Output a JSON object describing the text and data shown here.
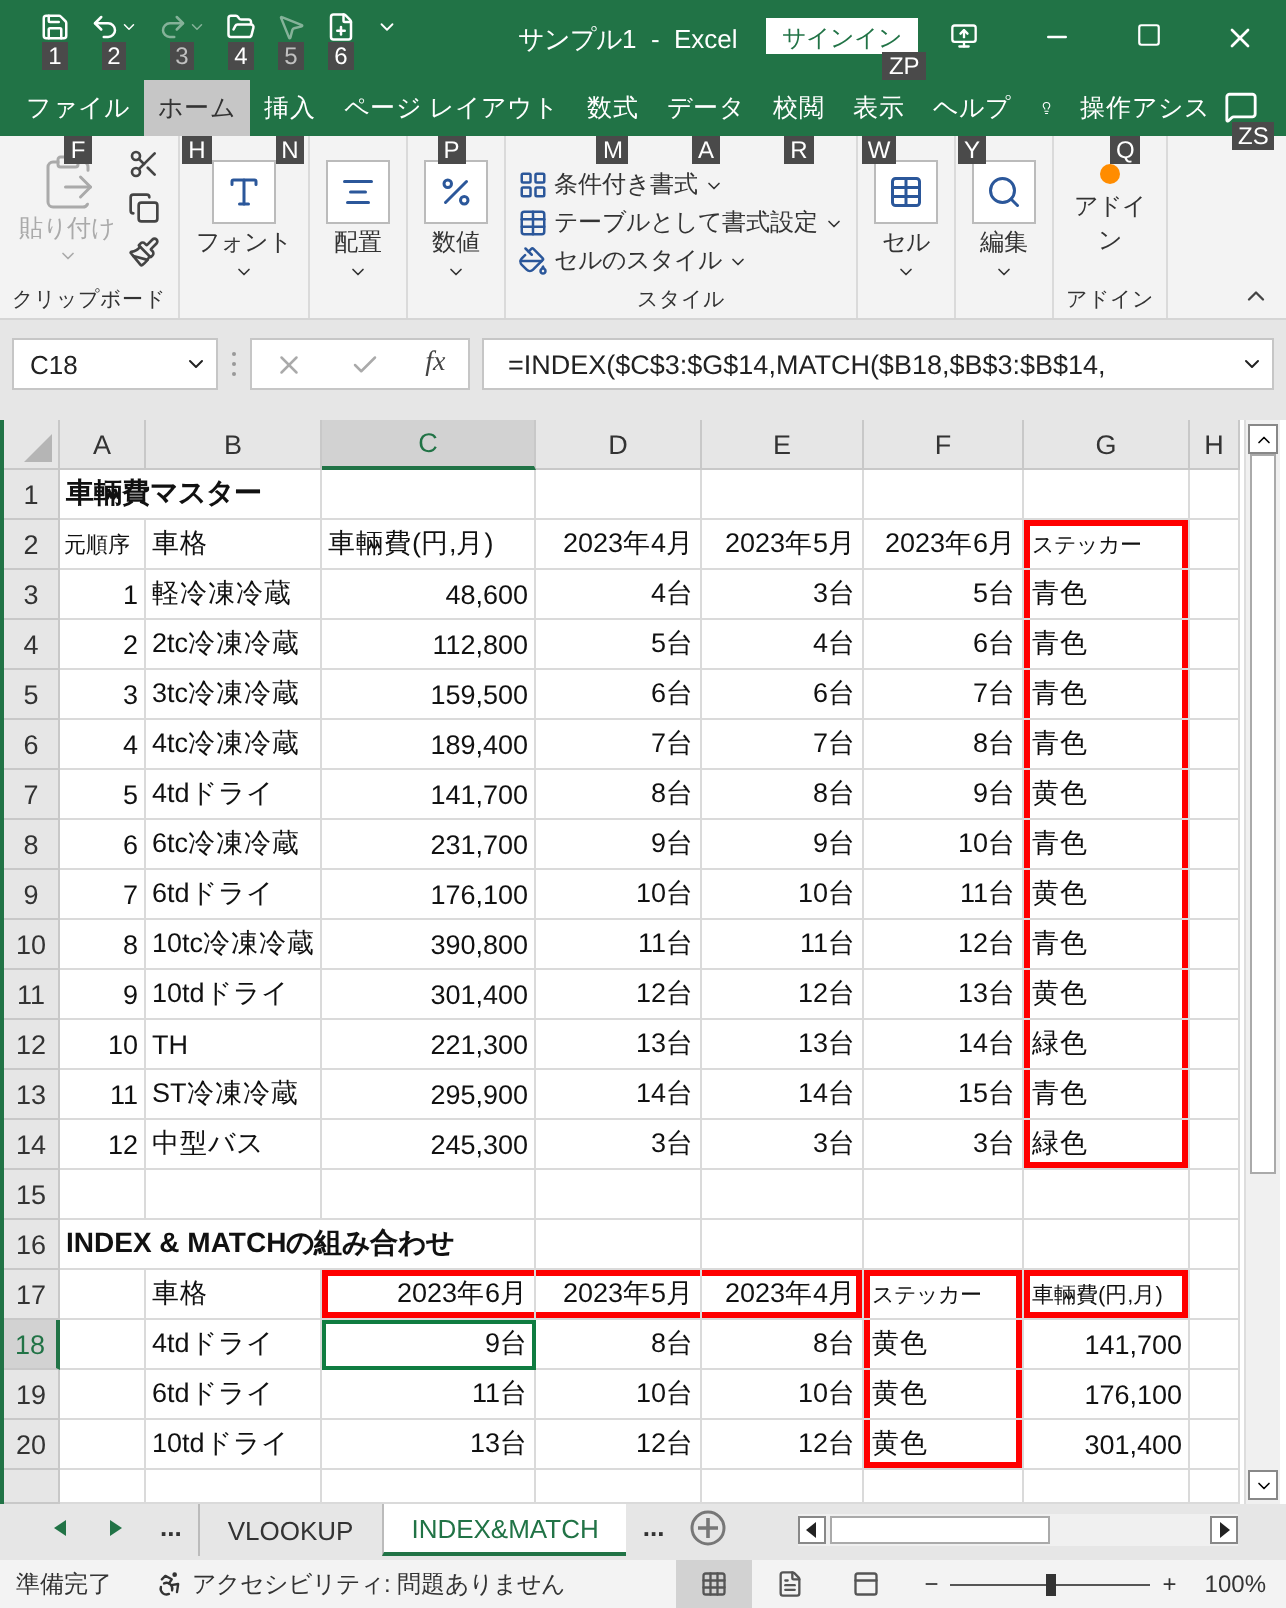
{
  "quick_access": [
    {
      "keytip": "1",
      "disabled": false
    },
    {
      "keytip": "2",
      "disabled": false
    },
    {
      "keytip": "3",
      "disabled": true
    },
    {
      "keytip": "4",
      "disabled": false
    },
    {
      "keytip": "5",
      "disabled": true
    },
    {
      "keytip": "6",
      "disabled": false
    }
  ],
  "window": {
    "title": "サンプル1  -  Excel",
    "sign_in": "サインイン",
    "sign_in_keytip": "ZP"
  },
  "tabs": [
    {
      "label": "ファイル",
      "keytip": "F",
      "selected": false
    },
    {
      "label": "ホーム",
      "keytip": "H",
      "selected": true
    },
    {
      "label": "挿入",
      "keytip": "N",
      "selected": false
    },
    {
      "label": "ページ レイアウト",
      "keytip": "P",
      "selected": false
    },
    {
      "label": "数式",
      "keytip": "M",
      "selected": false
    },
    {
      "label": "データ",
      "keytip": "A",
      "selected": false
    },
    {
      "label": "校閲",
      "keytip": "R",
      "selected": false
    },
    {
      "label": "表示",
      "keytip": "W",
      "selected": false
    },
    {
      "label": "ヘルプ",
      "keytip": "Y",
      "selected": false
    }
  ],
  "tell_me": {
    "label": "操作アシス",
    "keytip": "Q"
  },
  "comments_keytip": "ZS",
  "ribbon": [
    {
      "kind": "clipboard",
      "button": "貼り付け",
      "disabled": true,
      "label": "クリップボード"
    },
    {
      "kind": "big",
      "button": "フォント"
    },
    {
      "kind": "big",
      "button": "配置"
    },
    {
      "kind": "big",
      "button": "数値"
    },
    {
      "kind": "list",
      "items": [
        "条件付き書式",
        "テーブルとして書式設定",
        "セルのスタイル"
      ],
      "label": "スタイル"
    },
    {
      "kind": "big",
      "button": "セル"
    },
    {
      "kind": "big",
      "button": "編集"
    },
    {
      "kind": "addin",
      "button": "アドイン",
      "label": "アドイン"
    }
  ],
  "formula_bar": {
    "name_box": "C18",
    "fx": "fx",
    "formula": "=INDEX($C$3:$G$14,MATCH($B18,$B$3:$B$14,"
  },
  "columns": [
    {
      "label": "A",
      "selected": false
    },
    {
      "label": "B",
      "selected": false
    },
    {
      "label": "C",
      "selected": true
    },
    {
      "label": "D",
      "selected": false
    },
    {
      "label": "E",
      "selected": false
    },
    {
      "label": "F",
      "selected": false
    },
    {
      "label": "G",
      "selected": false
    },
    {
      "label": "H",
      "selected": false
    }
  ],
  "rows": [
    {
      "label": "1",
      "selected": false,
      "cells": [
        {
          "text": "車輛費マスター",
          "kind": "title"
        },
        null,
        null,
        null,
        null,
        null,
        null,
        null
      ]
    },
    {
      "label": "2",
      "selected": false,
      "cells": [
        {
          "text": "元順序",
          "kind": "small"
        },
        {
          "text": "車格",
          "kind": "text"
        },
        {
          "text": "車輛費(円,月)",
          "kind": "text"
        },
        {
          "text": "2023年4月",
          "kind": "num"
        },
        {
          "text": "2023年5月",
          "kind": "num"
        },
        {
          "text": "2023年6月",
          "kind": "num"
        },
        {
          "text": "ステッカー",
          "kind": "small",
          "framed": true
        },
        null
      ]
    },
    {
      "label": "3",
      "selected": false,
      "cells": [
        {
          "text": "1",
          "kind": "num"
        },
        {
          "text": "軽冷凍冷蔵",
          "kind": "text"
        },
        {
          "text": "48,600",
          "kind": "num"
        },
        {
          "text": "4台",
          "kind": "num"
        },
        {
          "text": "3台",
          "kind": "num"
        },
        {
          "text": "5台",
          "kind": "num"
        },
        {
          "text": "青色",
          "kind": "text",
          "framed": true
        },
        null
      ]
    },
    {
      "label": "4",
      "selected": false,
      "cells": [
        {
          "text": "2",
          "kind": "num"
        },
        {
          "text": "2tc冷凍冷蔵",
          "kind": "text"
        },
        {
          "text": "112,800",
          "kind": "num"
        },
        {
          "text": "5台",
          "kind": "num"
        },
        {
          "text": "4台",
          "kind": "num"
        },
        {
          "text": "6台",
          "kind": "num"
        },
        {
          "text": "青色",
          "kind": "text",
          "framed": true
        },
        null
      ]
    },
    {
      "label": "5",
      "selected": false,
      "cells": [
        {
          "text": "3",
          "kind": "num"
        },
        {
          "text": "3tc冷凍冷蔵",
          "kind": "text"
        },
        {
          "text": "159,500",
          "kind": "num"
        },
        {
          "text": "6台",
          "kind": "num"
        },
        {
          "text": "6台",
          "kind": "num"
        },
        {
          "text": "7台",
          "kind": "num"
        },
        {
          "text": "青色",
          "kind": "text",
          "framed": true
        },
        null
      ]
    },
    {
      "label": "6",
      "selected": false,
      "cells": [
        {
          "text": "4",
          "kind": "num"
        },
        {
          "text": "4tc冷凍冷蔵",
          "kind": "text"
        },
        {
          "text": "189,400",
          "kind": "num"
        },
        {
          "text": "7台",
          "kind": "num"
        },
        {
          "text": "7台",
          "kind": "num"
        },
        {
          "text": "8台",
          "kind": "num"
        },
        {
          "text": "青色",
          "kind": "text",
          "framed": true
        },
        null
      ]
    },
    {
      "label": "7",
      "selected": false,
      "cells": [
        {
          "text": "5",
          "kind": "num"
        },
        {
          "text": "4tdドライ",
          "kind": "text"
        },
        {
          "text": "141,700",
          "kind": "num"
        },
        {
          "text": "8台",
          "kind": "num"
        },
        {
          "text": "8台",
          "kind": "num"
        },
        {
          "text": "9台",
          "kind": "num"
        },
        {
          "text": "黄色",
          "kind": "text",
          "framed": true
        },
        null
      ]
    },
    {
      "label": "8",
      "selected": false,
      "cells": [
        {
          "text": "6",
          "kind": "num"
        },
        {
          "text": "6tc冷凍冷蔵",
          "kind": "text"
        },
        {
          "text": "231,700",
          "kind": "num"
        },
        {
          "text": "9台",
          "kind": "num"
        },
        {
          "text": "9台",
          "kind": "num"
        },
        {
          "text": "10台",
          "kind": "num"
        },
        {
          "text": "青色",
          "kind": "text",
          "framed": true
        },
        null
      ]
    },
    {
      "label": "9",
      "selected": false,
      "cells": [
        {
          "text": "7",
          "kind": "num"
        },
        {
          "text": "6tdドライ",
          "kind": "text"
        },
        {
          "text": "176,100",
          "kind": "num"
        },
        {
          "text": "10台",
          "kind": "num"
        },
        {
          "text": "10台",
          "kind": "num"
        },
        {
          "text": "11台",
          "kind": "num"
        },
        {
          "text": "黄色",
          "kind": "text",
          "framed": true
        },
        null
      ]
    },
    {
      "label": "10",
      "selected": false,
      "cells": [
        {
          "text": "8",
          "kind": "num"
        },
        {
          "text": "10tc冷凍冷蔵",
          "kind": "text"
        },
        {
          "text": "390,800",
          "kind": "num"
        },
        {
          "text": "11台",
          "kind": "num"
        },
        {
          "text": "11台",
          "kind": "num"
        },
        {
          "text": "12台",
          "kind": "num"
        },
        {
          "text": "青色",
          "kind": "text",
          "framed": true
        },
        null
      ]
    },
    {
      "label": "11",
      "selected": false,
      "cells": [
        {
          "text": "9",
          "kind": "num"
        },
        {
          "text": "10tdドライ",
          "kind": "text"
        },
        {
          "text": "301,400",
          "kind": "num"
        },
        {
          "text": "12台",
          "kind": "num"
        },
        {
          "text": "12台",
          "kind": "num"
        },
        {
          "text": "13台",
          "kind": "num"
        },
        {
          "text": "黄色",
          "kind": "text",
          "framed": true
        },
        null
      ]
    },
    {
      "label": "12",
      "selected": false,
      "cells": [
        {
          "text": "10",
          "kind": "num"
        },
        {
          "text": "TH",
          "kind": "text"
        },
        {
          "text": "221,300",
          "kind": "num"
        },
        {
          "text": "13台",
          "kind": "num"
        },
        {
          "text": "13台",
          "kind": "num"
        },
        {
          "text": "14台",
          "kind": "num"
        },
        {
          "text": "緑色",
          "kind": "text",
          "framed": true
        },
        null
      ]
    },
    {
      "label": "13",
      "selected": false,
      "cells": [
        {
          "text": "11",
          "kind": "num"
        },
        {
          "text": "ST冷凍冷蔵",
          "kind": "text"
        },
        {
          "text": "295,900",
          "kind": "num"
        },
        {
          "text": "14台",
          "kind": "num"
        },
        {
          "text": "14台",
          "kind": "num"
        },
        {
          "text": "15台",
          "kind": "num"
        },
        {
          "text": "青色",
          "kind": "text",
          "framed": true
        },
        null
      ]
    },
    {
      "label": "14",
      "selected": false,
      "cells": [
        {
          "text": "12",
          "kind": "num"
        },
        {
          "text": "中型バス",
          "kind": "text"
        },
        {
          "text": "245,300",
          "kind": "num"
        },
        {
          "text": "3台",
          "kind": "num"
        },
        {
          "text": "3台",
          "kind": "num"
        },
        {
          "text": "3台",
          "kind": "num"
        },
        {
          "text": "緑色",
          "kind": "text",
          "framed": true
        },
        null
      ]
    },
    {
      "label": "15",
      "selected": false,
      "cells": [
        null,
        null,
        null,
        null,
        null,
        null,
        null,
        null
      ]
    },
    {
      "label": "16",
      "selected": false,
      "cells": [
        {
          "text": "INDEX & MATCHの組み合わせ",
          "kind": "title"
        },
        null,
        null,
        null,
        null,
        null,
        null,
        null
      ]
    },
    {
      "label": "17",
      "selected": false,
      "cells": [
        null,
        {
          "text": "車格",
          "kind": "text"
        },
        {
          "text": "2023年6月",
          "kind": "num",
          "framed": true
        },
        {
          "text": "2023年5月",
          "kind": "num",
          "framed": true
        },
        {
          "text": "2023年4月",
          "kind": "num",
          "framed": true
        },
        {
          "text": "ステッカー",
          "kind": "small",
          "framed": true
        },
        {
          "text": "車輛費(円,月)",
          "kind": "small",
          "framed": true
        },
        null
      ]
    },
    {
      "label": "18",
      "selected": true,
      "cells": [
        null,
        {
          "text": "4tdドライ",
          "kind": "text"
        },
        {
          "text": "9台",
          "kind": "num"
        },
        {
          "text": "8台",
          "kind": "num"
        },
        {
          "text": "8台",
          "kind": "num"
        },
        {
          "text": "黄色",
          "kind": "text",
          "framed": true
        },
        {
          "text": "141,700",
          "kind": "num"
        },
        null
      ]
    },
    {
      "label": "19",
      "selected": false,
      "cells": [
        null,
        {
          "text": "6tdドライ",
          "kind": "text"
        },
        {
          "text": "11台",
          "kind": "num"
        },
        {
          "text": "10台",
          "kind": "num"
        },
        {
          "text": "10台",
          "kind": "num"
        },
        {
          "text": "黄色",
          "kind": "text",
          "framed": true
        },
        {
          "text": "176,100",
          "kind": "num"
        },
        null
      ]
    },
    {
      "label": "20",
      "selected": false,
      "cells": [
        null,
        {
          "text": "10tdドライ",
          "kind": "text"
        },
        {
          "text": "13台",
          "kind": "num"
        },
        {
          "text": "12台",
          "kind": "num"
        },
        {
          "text": "12台",
          "kind": "num"
        },
        {
          "text": "黄色",
          "kind": "text",
          "framed": true
        },
        {
          "text": "301,400",
          "kind": "num"
        },
        null
      ]
    }
  ],
  "sheet_tabs": {
    "more_left": "...",
    "more_right": "...",
    "tabs": [
      {
        "label": "VLOOKUP",
        "selected": false
      },
      {
        "label": "INDEX&MATCH",
        "selected": true
      }
    ]
  },
  "status_bar": {
    "ready": "準備完了",
    "accessibility": "アクセシビリティ: 問題ありません",
    "views": [
      {
        "selected": true
      },
      {
        "selected": false
      },
      {
        "selected": false
      }
    ],
    "zoom_out": "−",
    "zoom_in": "+",
    "zoom": {
      "level": 0.5
    },
    "zoom_text": "100%"
  }
}
